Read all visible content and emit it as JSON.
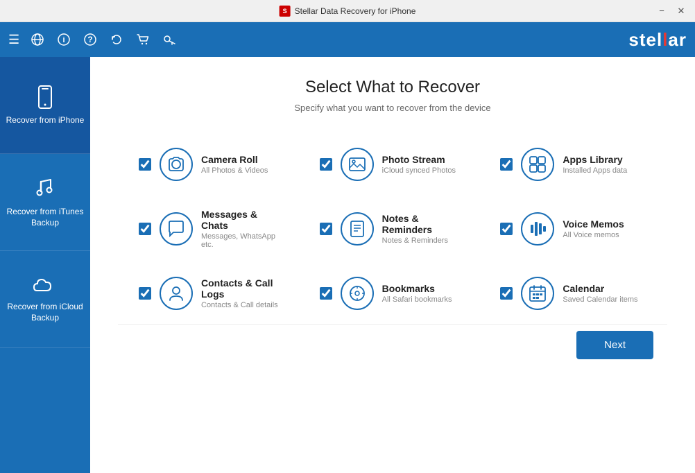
{
  "titlebar": {
    "title": "Stellar Data Recovery for iPhone",
    "minimize_label": "−",
    "close_label": "✕"
  },
  "toolbar": {
    "logo": "stellar",
    "logo_accent": "!"
  },
  "sidebar": {
    "items": [
      {
        "id": "iphone",
        "label": "Recover from iPhone",
        "active": true
      },
      {
        "id": "itunes",
        "label": "Recover from iTunes Backup",
        "active": false
      },
      {
        "id": "icloud",
        "label": "Recover from iCloud Backup",
        "active": false
      }
    ]
  },
  "content": {
    "title": "Select What to Recover",
    "subtitle": "Specify what you want to recover from the device"
  },
  "recovery_items": [
    {
      "id": "camera-roll",
      "name": "Camera Roll",
      "desc": "All Photos & Videos",
      "checked": true
    },
    {
      "id": "photo-stream",
      "name": "Photo Stream",
      "desc": "iCloud synced Photos",
      "checked": true
    },
    {
      "id": "apps-library",
      "name": "Apps Library",
      "desc": "Installed Apps data",
      "checked": true
    },
    {
      "id": "messages-chats",
      "name": "Messages & Chats",
      "desc": "Messages, WhatsApp etc.",
      "checked": true
    },
    {
      "id": "notes-reminders",
      "name": "Notes & Reminders",
      "desc": "Notes & Reminders",
      "checked": true
    },
    {
      "id": "voice-memos",
      "name": "Voice Memos",
      "desc": "All Voice memos",
      "checked": true
    },
    {
      "id": "contacts-logs",
      "name": "Contacts & Call Logs",
      "desc": "Contacts & Call details",
      "checked": true
    },
    {
      "id": "bookmarks",
      "name": "Bookmarks",
      "desc": "All Safari bookmarks",
      "checked": true
    },
    {
      "id": "calendar",
      "name": "Calendar",
      "desc": "Saved Calendar items",
      "checked": true
    }
  ],
  "footer": {
    "next_label": "Next"
  }
}
